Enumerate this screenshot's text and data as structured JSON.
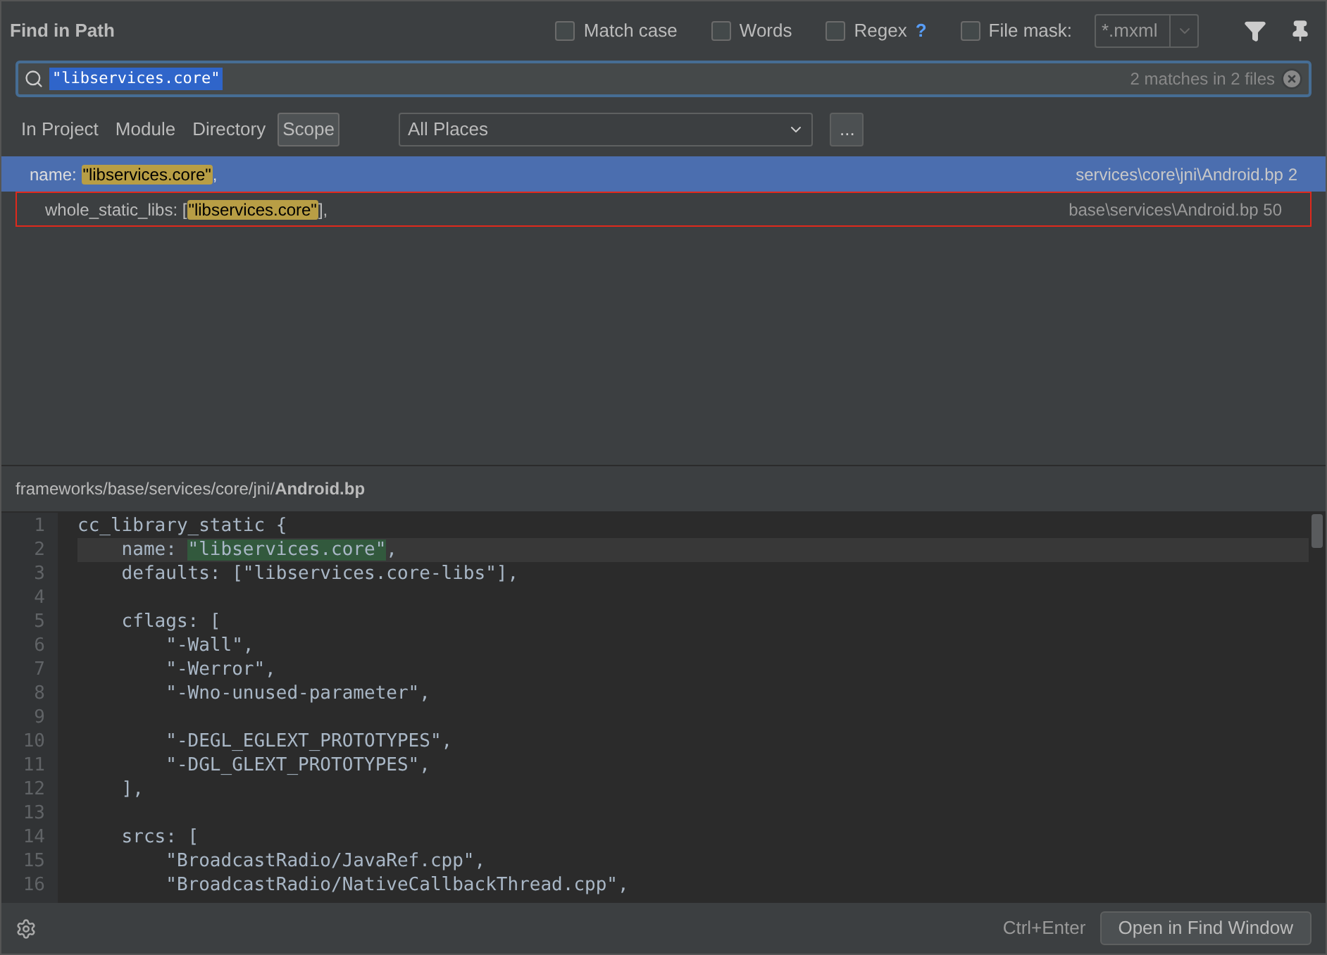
{
  "window": {
    "title": "Find in Path"
  },
  "options": [
    {
      "label": "Match case",
      "checked": false
    },
    {
      "label": "Words",
      "checked": false
    },
    {
      "label": "Regex",
      "checked": false,
      "help": "?"
    },
    {
      "label": "File mask:",
      "checked": false
    }
  ],
  "file_mask": {
    "value": "*.mxml"
  },
  "search": {
    "value": "\"libservices.core\"",
    "status": "2 matches in 2 files"
  },
  "scopes": [
    {
      "label": "In Project",
      "selected": false
    },
    {
      "label": "Module",
      "selected": false
    },
    {
      "label": "Directory",
      "selected": false
    },
    {
      "label": "Scope",
      "selected": true
    }
  ],
  "scope_dropdown": {
    "value": "All Places"
  },
  "browse_button": "...",
  "results": [
    {
      "before": "name: ",
      "match": "\"libservices.core\"",
      "after": ",",
      "location": "services\\core\\jni\\Android.bp 2",
      "selected": true,
      "outlined": false
    },
    {
      "before": "whole_static_libs: [",
      "match": "\"libservices.core\"",
      "after": "],",
      "location": "base\\services\\Android.bp 50",
      "selected": false,
      "outlined": true
    }
  ],
  "preview": {
    "path": "frameworks/base/services/core/jni/",
    "file": "Android.bp",
    "lines": [
      {
        "number": "1",
        "segments": [
          {
            "text": "cc_library_static {",
            "match": false
          }
        ],
        "current": false
      },
      {
        "number": "2",
        "segments": [
          {
            "text": "    name: ",
            "match": false
          },
          {
            "text": "\"libservices.core\"",
            "match": true
          },
          {
            "text": ",",
            "match": false
          }
        ],
        "current": true
      },
      {
        "number": "3",
        "segments": [
          {
            "text": "    defaults: [\"libservices.core-libs\"],",
            "match": false
          }
        ],
        "current": false
      },
      {
        "number": "4",
        "current": false
      },
      {
        "number": "5",
        "segments": [
          {
            "text": "    cflags: [",
            "match": false
          }
        ],
        "current": false
      },
      {
        "number": "6",
        "segments": [
          {
            "text": "        \"-Wall\",",
            "match": false
          }
        ],
        "current": false
      },
      {
        "number": "7",
        "segments": [
          {
            "text": "        \"-Werror\",",
            "match": false
          }
        ],
        "current": false
      },
      {
        "number": "8",
        "segments": [
          {
            "text": "        \"-Wno-unused-parameter\",",
            "match": false
          }
        ],
        "current": false
      },
      {
        "number": "9",
        "current": false
      },
      {
        "number": "10",
        "segments": [
          {
            "text": "        \"-DEGL_EGLEXT_PROTOTYPES\",",
            "match": false
          }
        ],
        "current": false
      },
      {
        "number": "11",
        "segments": [
          {
            "text": "        \"-DGL_GLEXT_PROTOTYPES\",",
            "match": false
          }
        ],
        "current": false
      },
      {
        "number": "12",
        "segments": [
          {
            "text": "    ],",
            "match": false
          }
        ],
        "current": false
      },
      {
        "number": "13",
        "current": false
      },
      {
        "number": "14",
        "segments": [
          {
            "text": "    srcs: [",
            "match": false
          }
        ],
        "current": false
      },
      {
        "number": "15",
        "segments": [
          {
            "text": "        \"BroadcastRadio/JavaRef.cpp\",",
            "match": false
          }
        ],
        "current": false
      },
      {
        "number": "16",
        "segments": [
          {
            "text": "        \"BroadcastRadio/NativeCallbackThread.cpp\",",
            "match": false
          }
        ],
        "current": false
      }
    ]
  },
  "footer": {
    "shortcut": "Ctrl+Enter",
    "button": "Open in Find Window"
  }
}
